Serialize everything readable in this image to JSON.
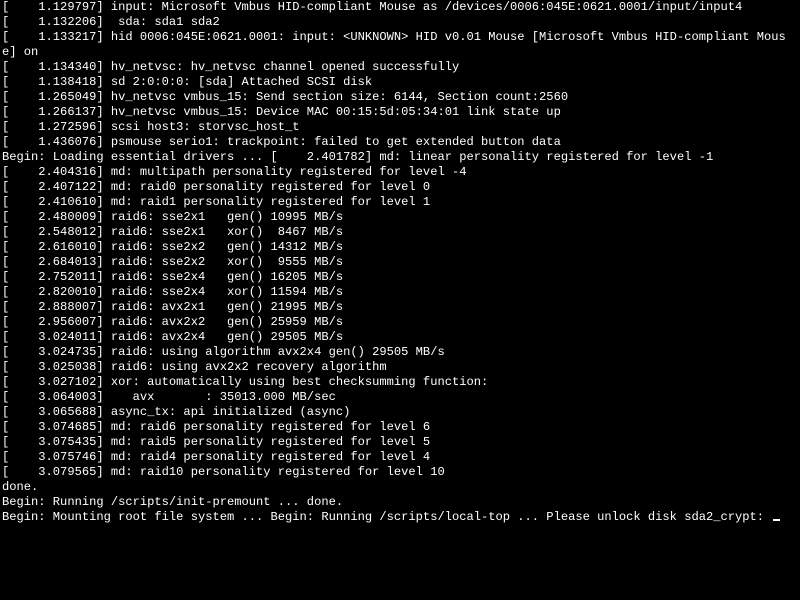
{
  "console": {
    "lines": [
      "[    1.129797] input: Microsoft Vmbus HID-compliant Mouse as /devices/0006:045E:0621.0001/input/input4",
      "[    1.132206]  sda: sda1 sda2",
      "[    1.133217] hid 0006:045E:0621.0001: input: <UNKNOWN> HID v0.01 Mouse [Microsoft Vmbus HID-compliant Mouse] on ",
      "[    1.134340] hv_netvsc: hv_netvsc channel opened successfully",
      "[    1.138418] sd 2:0:0:0: [sda] Attached SCSI disk",
      "[    1.265049] hv_netvsc vmbus_15: Send section size: 6144, Section count:2560",
      "[    1.266137] hv_netvsc vmbus_15: Device MAC 00:15:5d:05:34:01 link state up",
      "[    1.272596] scsi host3: storvsc_host_t",
      "[    1.436076] psmouse serio1: trackpoint: failed to get extended button data",
      "Begin: Loading essential drivers ... [    2.401782] md: linear personality registered for level -1",
      "[    2.404316] md: multipath personality registered for level -4",
      "[    2.407122] md: raid0 personality registered for level 0",
      "[    2.410610] md: raid1 personality registered for level 1",
      "[    2.480009] raid6: sse2x1   gen() 10995 MB/s",
      "[    2.548012] raid6: sse2x1   xor()  8467 MB/s",
      "[    2.616010] raid6: sse2x2   gen() 14312 MB/s",
      "[    2.684013] raid6: sse2x2   xor()  9555 MB/s",
      "[    2.752011] raid6: sse2x4   gen() 16205 MB/s",
      "[    2.820010] raid6: sse2x4   xor() 11594 MB/s",
      "[    2.888007] raid6: avx2x1   gen() 21995 MB/s",
      "[    2.956007] raid6: avx2x2   gen() 25959 MB/s",
      "[    3.024011] raid6: avx2x4   gen() 29505 MB/s",
      "[    3.024735] raid6: using algorithm avx2x4 gen() 29505 MB/s",
      "[    3.025038] raid6: using avx2x2 recovery algorithm",
      "[    3.027102] xor: automatically using best checksumming function:",
      "[    3.064003]    avx       : 35013.000 MB/sec",
      "[    3.065688] async_tx: api initialized (async)",
      "[    3.074685] md: raid6 personality registered for level 6",
      "[    3.075435] md: raid5 personality registered for level 5",
      "[    3.075746] md: raid4 personality registered for level 4",
      "[    3.079565] md: raid10 personality registered for level 10",
      "done.",
      "Begin: Running /scripts/init-premount ... done.",
      "Begin: Mounting root file system ... Begin: Running /scripts/local-top ... Please unlock disk sda2_crypt: "
    ]
  }
}
